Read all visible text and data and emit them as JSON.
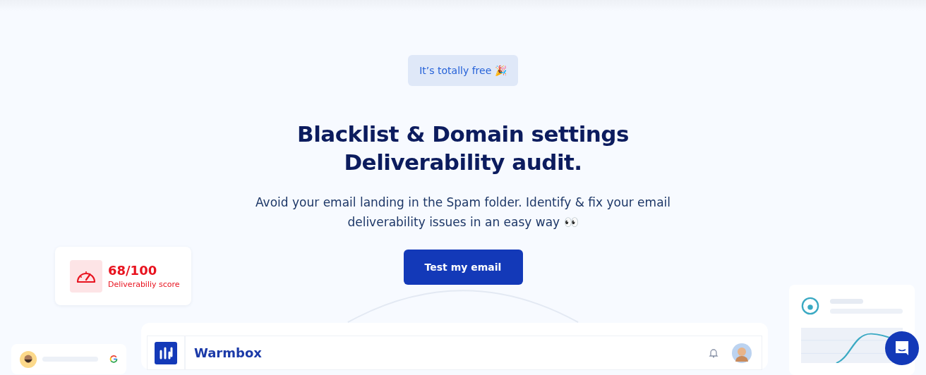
{
  "badge": {
    "text": "It’s totally free 🎉"
  },
  "heading": {
    "lines": [
      "Blacklist & Domain settings",
      "Deliverability audit."
    ]
  },
  "subtitle": {
    "lines": [
      "Avoid your email landing in the Spam folder. Identify & fix your email",
      "deliverability issues in an easy way 👀"
    ]
  },
  "cta": {
    "label": "Test my email"
  },
  "score_card": {
    "value": "68/100",
    "label": "Deliverabiliy score"
  },
  "dashboard": {
    "brand": "Warmbox"
  }
}
